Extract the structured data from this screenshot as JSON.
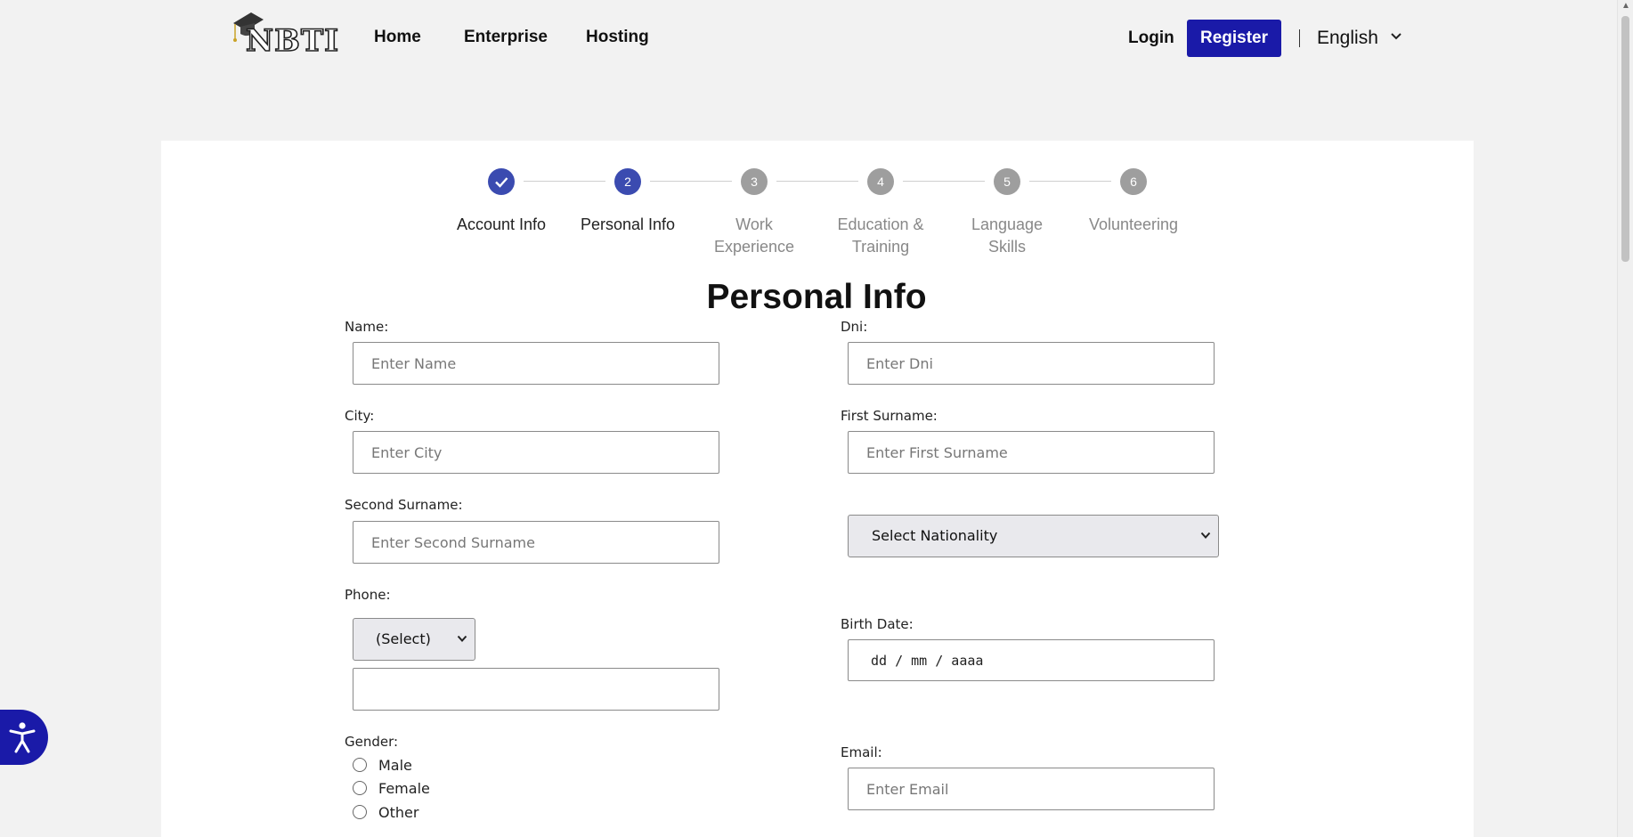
{
  "header": {
    "logo_text": "NBTI",
    "nav": [
      "Home",
      "Enterprise",
      "Hosting"
    ],
    "login_label": "Login",
    "register_label": "Register",
    "language": "English"
  },
  "stepper": {
    "steps": [
      {
        "number": "1",
        "label_line1": "Account Info",
        "label_line2": "",
        "state": "done"
      },
      {
        "number": "2",
        "label_line1": "Personal Info",
        "label_line2": "",
        "state": "current"
      },
      {
        "number": "3",
        "label_line1": "Work",
        "label_line2": "Experience",
        "state": "todo"
      },
      {
        "number": "4",
        "label_line1": "Education &",
        "label_line2": "Training",
        "state": "todo"
      },
      {
        "number": "5",
        "label_line1": "Language",
        "label_line2": "Skills",
        "state": "todo"
      },
      {
        "number": "6",
        "label_line1": "Volunteering",
        "label_line2": "",
        "state": "todo"
      }
    ]
  },
  "form": {
    "title": "Personal Info",
    "name": {
      "label": "Name:",
      "placeholder": "Enter Name",
      "value": ""
    },
    "dni": {
      "label": "Dni:",
      "placeholder": "Enter Dni",
      "value": ""
    },
    "city": {
      "label": "City:",
      "placeholder": "Enter City",
      "value": ""
    },
    "first_surname": {
      "label": "First Surname:",
      "placeholder": "Enter First Surname",
      "value": ""
    },
    "second_surname": {
      "label": "Second Surname:",
      "placeholder": "Enter Second Surname",
      "value": ""
    },
    "nationality": {
      "selected": "Select Nationality"
    },
    "phone": {
      "label": "Phone:",
      "code_selected": "(Select)",
      "value": ""
    },
    "birth_date": {
      "label": "Birth Date:",
      "placeholder": "dd / mm / aaaa"
    },
    "gender": {
      "label": "Gender:",
      "options": [
        "Male",
        "Female",
        "Other"
      ]
    },
    "email": {
      "label": "Email:",
      "placeholder": "Enter Email",
      "value": ""
    }
  },
  "colors": {
    "brand": "#1a1aa8",
    "step_active": "#3b4bb0",
    "step_inactive": "#9e9e9e"
  }
}
